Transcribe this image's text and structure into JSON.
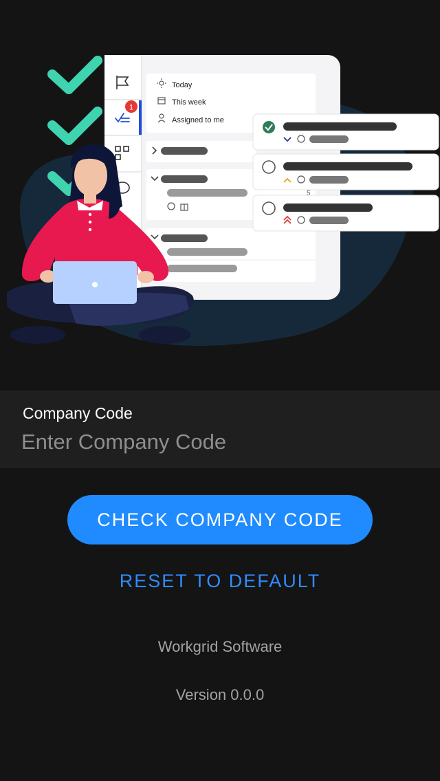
{
  "hero": {
    "illustration": "person-with-laptop-task-list",
    "sidebar_nav": [
      "flag-icon",
      "tasks-icon",
      "grid-icon",
      "chat-icon"
    ],
    "badge_count": "1",
    "filters": [
      {
        "icon": "sun-icon",
        "label": "Today"
      },
      {
        "icon": "calendar-icon",
        "label": "This week"
      },
      {
        "icon": "person-icon",
        "label": "Assigned to me"
      }
    ],
    "small_number": "5",
    "colors": {
      "check_green": "#3fd3b0",
      "blob": "#15293a",
      "shirt": "#e8194f",
      "laptop": "#b6d1ff",
      "priority_orange": "#f59e0b",
      "priority_red": "#e53935",
      "priority_blue": "#1e3a8a"
    }
  },
  "form": {
    "label": "Company Code",
    "placeholder": "Enter Company Code",
    "value": ""
  },
  "actions": {
    "check_label": "CHECK COMPANY CODE",
    "reset_label": "RESET TO DEFAULT"
  },
  "footer": {
    "company": "Workgrid Software",
    "version": "Version 0.0.0"
  },
  "colors": {
    "background": "#141414",
    "field_background": "#1f1f1f",
    "primary": "#1f8bff",
    "link": "#2f8cff"
  }
}
